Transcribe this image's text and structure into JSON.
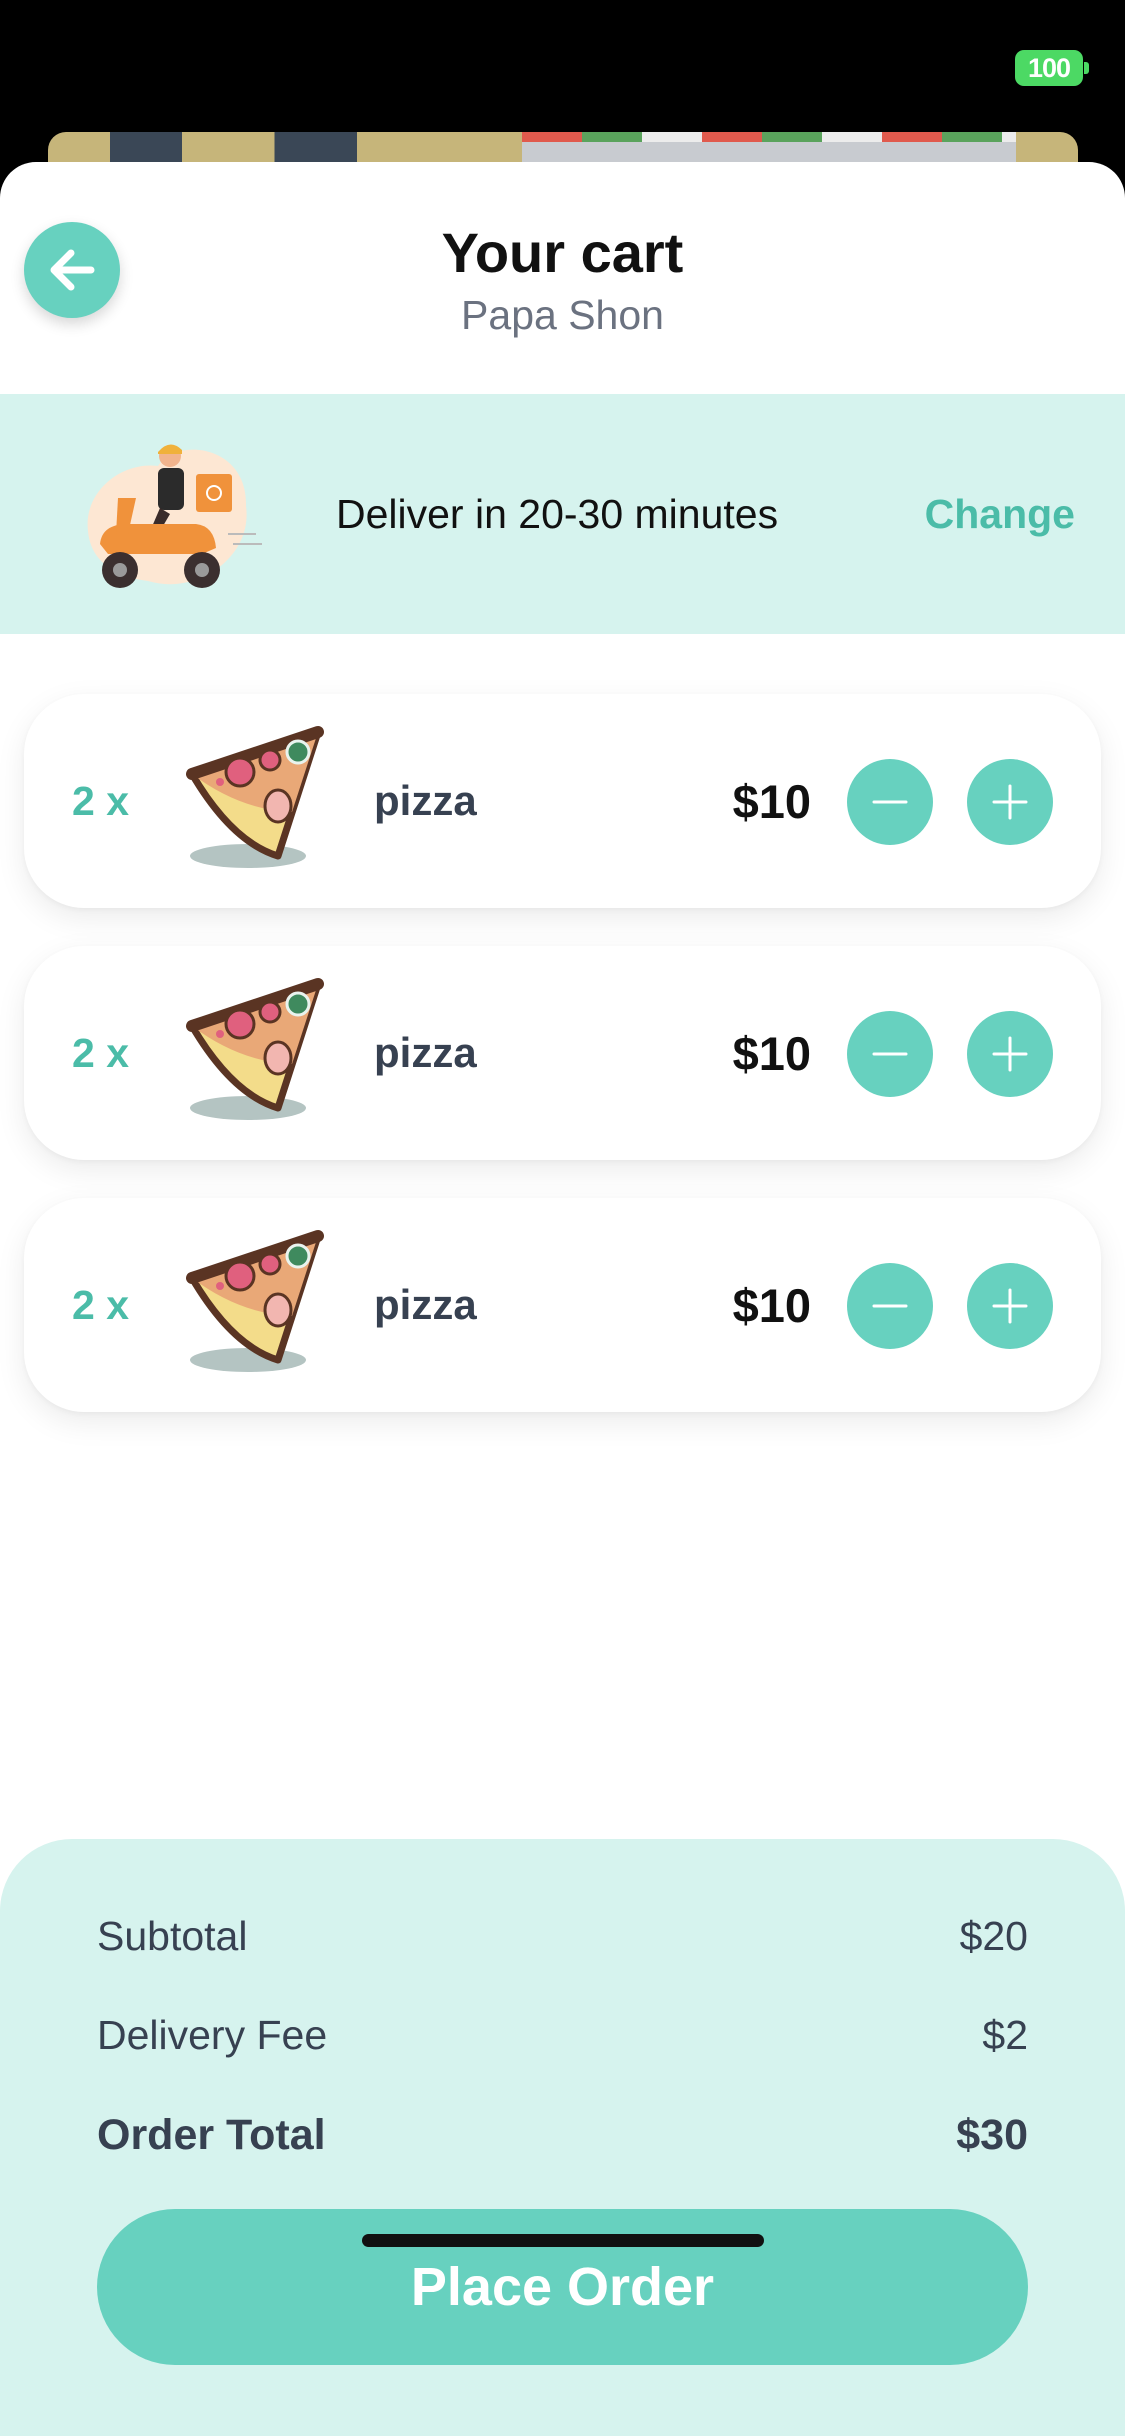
{
  "status_bar": {
    "battery": "100"
  },
  "header": {
    "title": "Your cart",
    "subtitle": "Papa Shon"
  },
  "delivery": {
    "text": "Deliver in 20-30 minutes",
    "change_label": "Change"
  },
  "cart": {
    "items": [
      {
        "qty": "2 x",
        "name": "pizza",
        "price": "$10"
      },
      {
        "qty": "2 x",
        "name": "pizza",
        "price": "$10"
      },
      {
        "qty": "2 x",
        "name": "pizza",
        "price": "$10"
      }
    ]
  },
  "summary": {
    "subtotal_label": "Subtotal",
    "subtotal_value": "$20",
    "delivery_fee_label": "Delivery Fee",
    "delivery_fee_value": "$2",
    "total_label": "Order Total",
    "total_value": "$30"
  },
  "actions": {
    "place_order": "Place Order"
  },
  "colors": {
    "accent": "#67d1bf",
    "accent_text": "#4bbca8",
    "banner_bg": "#d6f3ee"
  },
  "icons": {
    "back": "arrow-left-icon",
    "minus": "minus-icon",
    "plus": "plus-icon",
    "item_image": "pizza-slice-icon",
    "delivery": "delivery-scooter-illustration"
  }
}
